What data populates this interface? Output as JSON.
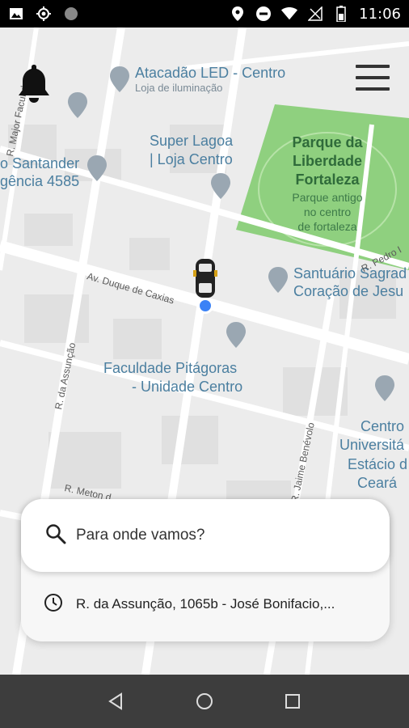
{
  "status_bar": {
    "time": "11:06",
    "left_icons": [
      "image-icon",
      "location-crosshair-icon",
      "circle-icon"
    ],
    "right_icons": [
      "location-pin-icon",
      "do-not-disturb-icon",
      "wifi-icon",
      "no-signal-icon",
      "battery-icon"
    ]
  },
  "map": {
    "labels": {
      "atacadao": "Atacadão LED - Centro",
      "atacadao_sub": "Loja de iluminação",
      "santander": "o Santander",
      "santander2": "gência 4585",
      "superlagoa": "Super Lagoa",
      "superlagoa2": "| Loja Centro",
      "parque1": "Parque da",
      "parque2": "Liberdade",
      "parque3": "Fortaleza",
      "parque_sub1": "Parque antigo",
      "parque_sub2": "no centro",
      "parque_sub3": "de fortaleza",
      "santuario1": "Santuário Sagrad",
      "santuario2": "Coração de Jesu",
      "faculdade1": "Faculdade Pitágoras",
      "faculdade2": "- Unidade Centro",
      "centro1": "Centro",
      "centro2": "Universitá",
      "centro3": "Estácio d",
      "centro4": "Ceará"
    },
    "streets": {
      "duque": "Av. Duque de Caxias",
      "assuncao": "R. da Assunção",
      "metom": "R. Meton d",
      "major": "R. Major Facundo",
      "pedro": "R. Pedro I",
      "jaime": "R. Jaime Benévolo"
    }
  },
  "header": {
    "bell_icon": "bell-icon",
    "menu_icon": "hamburger-menu-icon"
  },
  "search": {
    "placeholder": "Para onde vamos?",
    "recent_address": "R. da Assunção, 1065b - José Bonifacio,..."
  },
  "nav_bar": {
    "buttons": [
      "back-icon",
      "home-icon",
      "recents-icon"
    ]
  },
  "colors": {
    "park": "#8fd07f",
    "map_bg": "#ececec",
    "road": "#ffffff",
    "location_dot": "#3b82f6",
    "label_blue": "#4b7fa0"
  }
}
